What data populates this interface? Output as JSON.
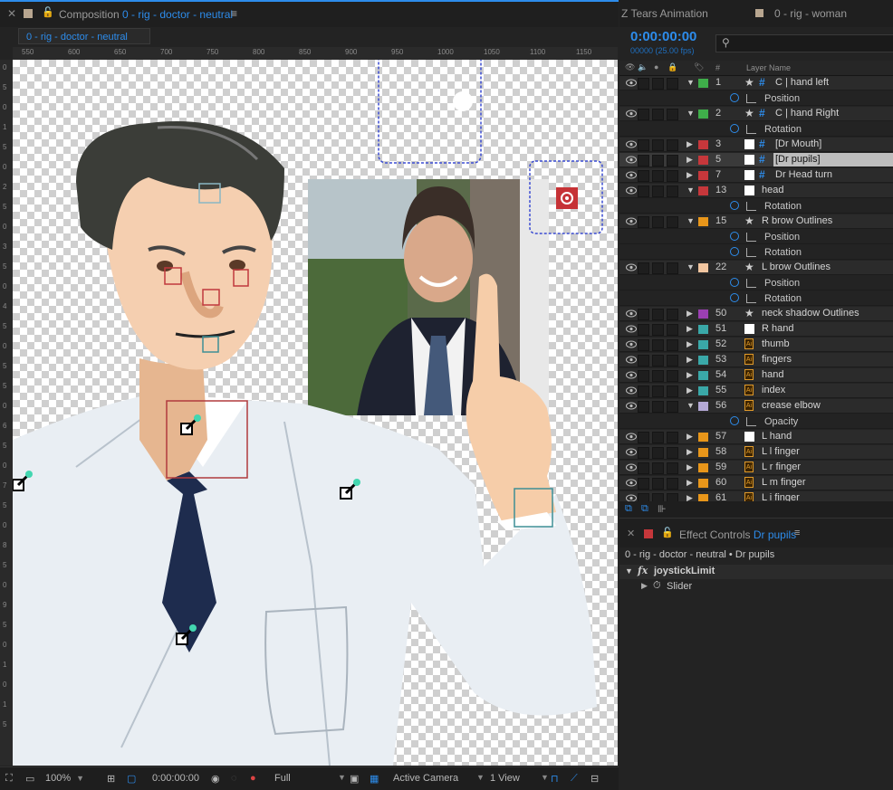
{
  "composition_panel": {
    "title_prefix": "Composition",
    "title_name": "0 - rig - doctor - neutral",
    "menu_icon": "hamburger-icon",
    "tab_label": "0 - rig - doctor - neutral",
    "ruler_top": [
      "550",
      "600",
      "650",
      "700",
      "750",
      "800",
      "850",
      "900",
      "950",
      "1000",
      "1050",
      "1100",
      "1150"
    ],
    "ruler_left": [
      "0",
      "5",
      "0",
      "1",
      "5",
      "0",
      "2",
      "5",
      "0",
      "3",
      "5",
      "0",
      "4",
      "5",
      "0",
      "5",
      "5",
      "0",
      "6",
      "5",
      "0",
      "7",
      "5",
      "0",
      "8",
      "5",
      "0",
      "9",
      "5",
      "0",
      "1",
      "0",
      "1",
      "5"
    ]
  },
  "viewer_footer": {
    "zoom": "100%",
    "timecode": "0:00:00:00",
    "resolution": "Full",
    "camera": "Active Camera",
    "views": "1 View"
  },
  "timeline": {
    "tab1": "Z Tears Animation",
    "tab2": "0 - rig - woman",
    "timecode": "0:00:00:00",
    "fps": "00000 (25.00 fps)",
    "col_hash": "#",
    "col_layer_name": "Layer Name",
    "colors": {
      "green": "#3fae4a",
      "red": "#c6373b",
      "orange": "#e8961a",
      "peach": "#f2c6a0",
      "purple": "#9b3fb2",
      "teal": "#3aa8a8",
      "lavender": "#b4a9d6",
      "white": "#ffffff"
    },
    "rows": [
      {
        "kind": "layer",
        "num": "1",
        "icon": "star-hash-icon",
        "name": "C | hand left",
        "label": "green",
        "twirl": "down"
      },
      {
        "kind": "prop",
        "name": "Position"
      },
      {
        "kind": "layer",
        "num": "2",
        "icon": "star-hash-icon",
        "name": "C | hand Right",
        "label": "green",
        "twirl": "down"
      },
      {
        "kind": "prop",
        "name": "Rotation"
      },
      {
        "kind": "layer",
        "num": "3",
        "icon": "box-hash-icon",
        "name": "[Dr Mouth]",
        "label": "red",
        "twirl": "right"
      },
      {
        "kind": "layer",
        "num": "5",
        "icon": "box-hash-icon",
        "name": "[Dr pupils]",
        "label": "red",
        "twirl": "right",
        "selected": true
      },
      {
        "kind": "layer",
        "num": "7",
        "icon": "box-hash-icon",
        "name": "Dr Head turn",
        "label": "red",
        "twirl": "right"
      },
      {
        "kind": "layer",
        "num": "13",
        "icon": "box-icon",
        "name": "head",
        "label": "red",
        "twirl": "down"
      },
      {
        "kind": "prop",
        "name": "Rotation"
      },
      {
        "kind": "layer",
        "num": "15",
        "icon": "star-icon",
        "name": "R brow Outlines",
        "label": "orange",
        "twirl": "down"
      },
      {
        "kind": "prop",
        "name": "Position"
      },
      {
        "kind": "prop",
        "name": "Rotation"
      },
      {
        "kind": "layer",
        "num": "22",
        "icon": "star-icon",
        "name": "L brow Outlines",
        "label": "peach",
        "twirl": "down"
      },
      {
        "kind": "prop",
        "name": "Position"
      },
      {
        "kind": "prop",
        "name": "Rotation"
      },
      {
        "kind": "layer",
        "num": "50",
        "icon": "star-icon",
        "name": "neck shadow Outlines",
        "label": "purple",
        "twirl": "right"
      },
      {
        "kind": "layer",
        "num": "51",
        "icon": "box-icon",
        "name": "R hand",
        "label": "teal",
        "twirl": "right"
      },
      {
        "kind": "layer",
        "num": "52",
        "icon": "ai-file-icon",
        "name": "thumb",
        "label": "teal",
        "twirl": "right"
      },
      {
        "kind": "layer",
        "num": "53",
        "icon": "ai-file-icon",
        "name": "fingers",
        "label": "teal",
        "twirl": "right"
      },
      {
        "kind": "layer",
        "num": "54",
        "icon": "ai-file-icon",
        "name": "hand",
        "label": "teal",
        "twirl": "right"
      },
      {
        "kind": "layer",
        "num": "55",
        "icon": "ai-file-icon",
        "name": "index",
        "label": "teal",
        "twirl": "right"
      },
      {
        "kind": "layer",
        "num": "56",
        "icon": "ai-file-icon",
        "name": "crease elbow",
        "label": "lavender",
        "twirl": "down"
      },
      {
        "kind": "prop",
        "name": "Opacity"
      },
      {
        "kind": "layer",
        "num": "57",
        "icon": "box-icon",
        "name": "L hand",
        "label": "orange",
        "twirl": "right"
      },
      {
        "kind": "layer",
        "num": "58",
        "icon": "ai-file-icon",
        "name": "L l finger",
        "label": "orange",
        "twirl": "right"
      },
      {
        "kind": "layer",
        "num": "59",
        "icon": "ai-file-icon",
        "name": "L r finger",
        "label": "orange",
        "twirl": "right"
      },
      {
        "kind": "layer",
        "num": "60",
        "icon": "ai-file-icon",
        "name": "L m finger",
        "label": "orange",
        "twirl": "right"
      },
      {
        "kind": "layer",
        "num": "61",
        "icon": "ai-file-icon",
        "name": "L i finger",
        "label": "orange",
        "twirl": "right"
      }
    ]
  },
  "effect_controls": {
    "title_prefix": "Effect Controls",
    "title_layer": "Dr pupils",
    "breadcrumb": "0 - rig - doctor - neutral • Dr pupils",
    "effect_name": "joystickLimit",
    "fx_label": "fx",
    "param": "Slider"
  }
}
